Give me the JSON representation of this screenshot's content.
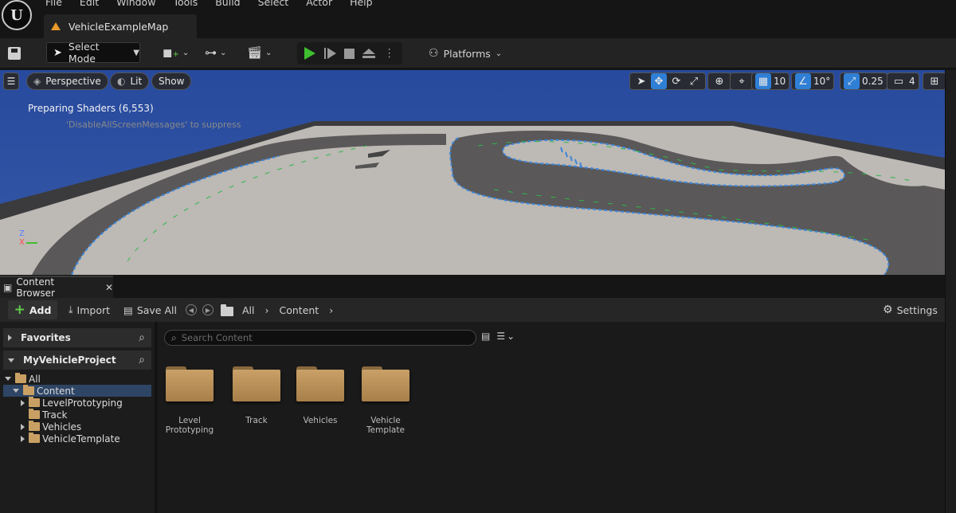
{
  "menu": {
    "logo": "U",
    "items": [
      "File",
      "Edit",
      "Window",
      "Tools",
      "Build",
      "Select",
      "Actor",
      "Help"
    ]
  },
  "document_tab": {
    "title": "VehicleExampleMap"
  },
  "toolbar": {
    "select_mode_label": "Select Mode",
    "platforms_label": "Platforms"
  },
  "viewport": {
    "view_label": "Perspective",
    "lit_label": "Lit",
    "show_label": "Show",
    "grid_snap_value": "10",
    "rotation_snap_value": "10°",
    "scale_snap_value": "0.25",
    "camera_speed_value": "4",
    "status_message": "Preparing Shaders (6,553)",
    "suppress_message": "'DisableAllScreenMessages' to suppress",
    "axis_z": "Z",
    "axis_x": "X",
    "sky_color": "#2f4d9a",
    "accent_color": "#2f7fd6"
  },
  "content_browser": {
    "tab_label": "Content Browser",
    "toolbar": {
      "add_label": "Add",
      "import_label": "Import",
      "save_all_label": "Save All",
      "breadcrumb_all": "All",
      "breadcrumb_content": "Content",
      "settings_label": "Settings"
    },
    "favorites_label": "Favorites",
    "project_label": "MyVehicleProject",
    "tree": [
      {
        "label": "All",
        "depth": 0,
        "expanded": true
      },
      {
        "label": "Content",
        "depth": 1,
        "expanded": true,
        "selected": true
      },
      {
        "label": "LevelPrototyping",
        "depth": 2,
        "expandable": true
      },
      {
        "label": "Track",
        "depth": 2,
        "expandable": false
      },
      {
        "label": "Vehicles",
        "depth": 2,
        "expandable": true
      },
      {
        "label": "VehicleTemplate",
        "depth": 2,
        "expandable": true
      }
    ],
    "search_placeholder": "Search Content",
    "folders": [
      {
        "label": "Level Prototyping"
      },
      {
        "label": "Track"
      },
      {
        "label": "Vehicles"
      },
      {
        "label": "Vehicle Template"
      }
    ]
  }
}
